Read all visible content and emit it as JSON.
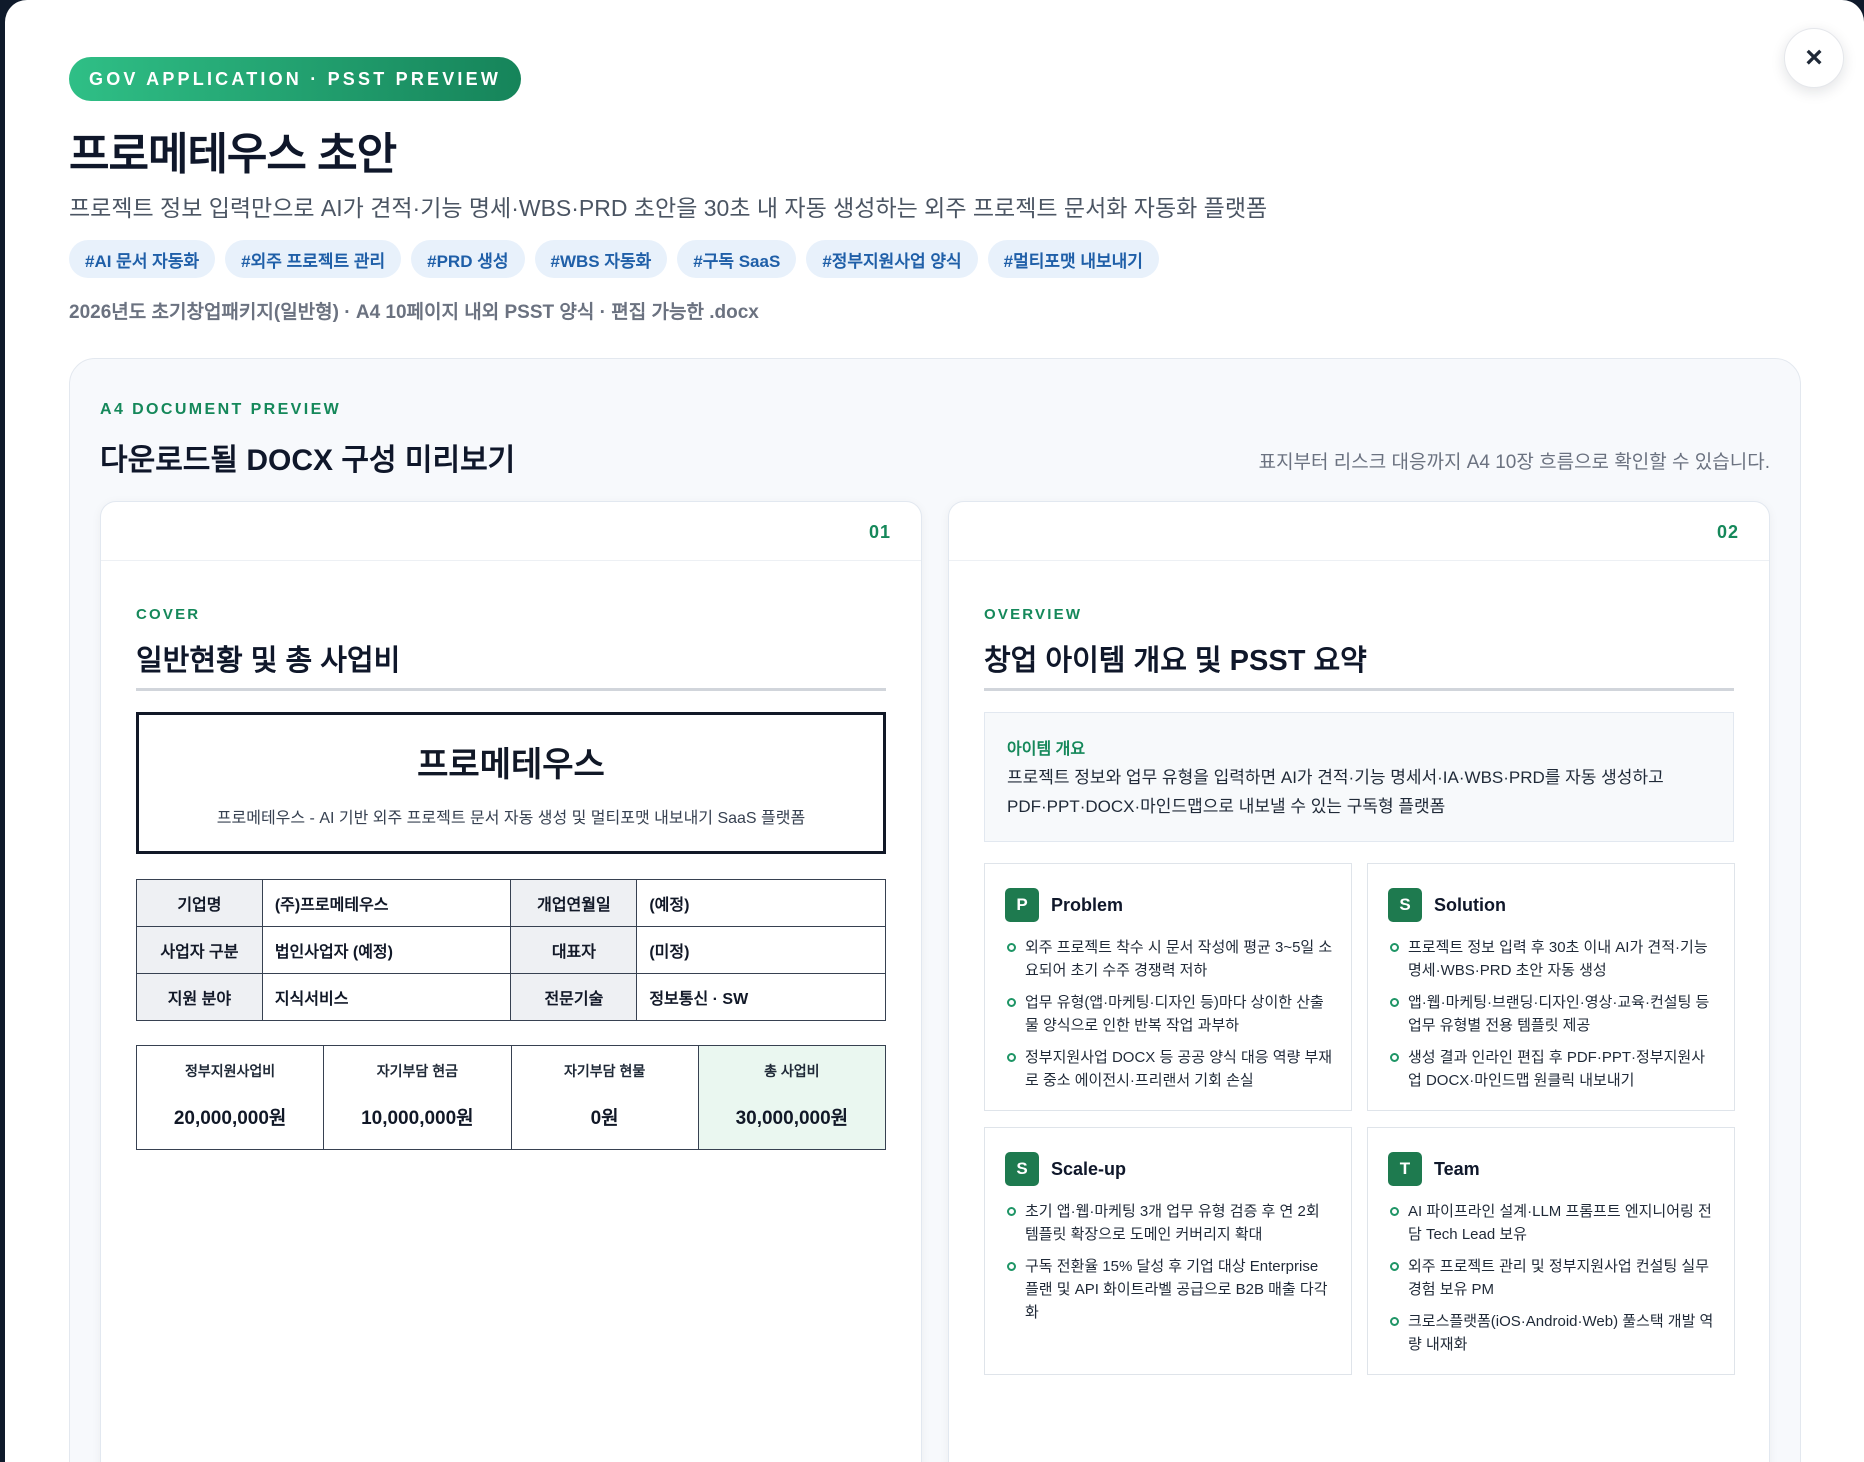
{
  "close_icon": "×",
  "hero": {
    "badge": "GOV APPLICATION · PSST PREVIEW",
    "title": "프로메테우스 초안",
    "subtitle": "프로젝트 정보 입력만으로 AI가 견적·기능 명세·WBS·PRD 초안을 30초 내 자동 생성하는 외주 프로젝트 문서화 자동화 플랫폼",
    "tags": [
      "#AI 문서 자동화",
      "#외주 프로젝트 관리",
      "#PRD 생성",
      "#WBS 자동화",
      "#구독 SaaS",
      "#정부지원사업 양식",
      "#멀티포맷 내보내기"
    ],
    "meta": "2026년도 초기창업패키지(일반형) · A4 10페이지 내외 PSST 양식 · 편집 가능한 .docx"
  },
  "preview": {
    "eyebrow": "A4 DOCUMENT PREVIEW",
    "title": "다운로드될 DOCX 구성 미리보기",
    "note": "표지부터 리스크 대응까지 A4 10장 흐름으로 확인할 수 있습니다."
  },
  "pages": {
    "cover": {
      "num": "01",
      "eyebrow": "COVER",
      "title": "일반현황 및 총 사업비",
      "company_name": "프로메테우스",
      "company_desc": "프로메테우스 - AI 기반 외주 프로젝트 문서 자동 생성 및 멀티포맷 내보내기 SaaS 플랫폼",
      "info": [
        [
          "기업명",
          "(주)프로메테우스",
          "개업연월일",
          "(예정)"
        ],
        [
          "사업자 구분",
          "법인사업자 (예정)",
          "대표자",
          "(미정)"
        ],
        [
          "지원 분야",
          "지식서비스",
          "전문기술",
          "정보통신 · SW"
        ]
      ],
      "budget": [
        {
          "label": "정부지원사업비",
          "value": "20,000,000원"
        },
        {
          "label": "자기부담 현금",
          "value": "10,000,000원"
        },
        {
          "label": "자기부담 현물",
          "value": "0원"
        },
        {
          "label": "총 사업비",
          "value": "30,000,000원"
        }
      ]
    },
    "overview": {
      "num": "02",
      "eyebrow": "OVERVIEW",
      "title": "창업 아이템 개요 및 PSST 요약",
      "item_label": "아이템 개요",
      "item_text": "프로젝트 정보와 업무 유형을 입력하면 AI가 견적·기능 명세서·IA·WBS·PRD를 자동 생성하고 PDF·PPT·DOCX·마인드맵으로 내보낼 수 있는 구독형 플랫폼",
      "cards": [
        {
          "letter": "P",
          "name": "Problem",
          "items": [
            "외주 프로젝트 착수 시 문서 작성에 평균 3~5일 소요되어 초기 수주 경쟁력 저하",
            "업무 유형(앱·마케팅·디자인 등)마다 상이한 산출물 양식으로 인한 반복 작업 과부하",
            "정부지원사업 DOCX 등 공공 양식 대응 역량 부재로 중소 에이전시·프리랜서 기회 손실"
          ]
        },
        {
          "letter": "S",
          "name": "Solution",
          "items": [
            "프로젝트 정보 입력 후 30초 이내 AI가 견적·기능 명세·WBS·PRD 초안 자동 생성",
            "앱·웹·마케팅·브랜딩·디자인·영상·교육·컨설팅 등 업무 유형별 전용 템플릿 제공",
            "생성 결과 인라인 편집 후 PDF·PPT·정부지원사업 DOCX·마인드맵 원클릭 내보내기"
          ]
        },
        {
          "letter": "S",
          "name": "Scale-up",
          "items": [
            "초기 앱·웹·마케팅 3개 업무 유형 검증 후 연 2회 템플릿 확장으로 도메인 커버리지 확대",
            "구독 전환율 15% 달성 후 기업 대상 Enterprise 플랜 및 API 화이트라벨 공급으로 B2B 매출 다각화"
          ]
        },
        {
          "letter": "T",
          "name": "Team",
          "items": [
            "AI 파이프라인 설계·LLM 프롬프트 엔지니어링 전담 Tech Lead 보유",
            "외주 프로젝트 관리 및 정부지원사업 컨설팅 실무 경험 보유 PM",
            "크로스플랫폼(iOS·Android·Web) 풀스택 개발 역량 내재화"
          ]
        }
      ]
    }
  }
}
